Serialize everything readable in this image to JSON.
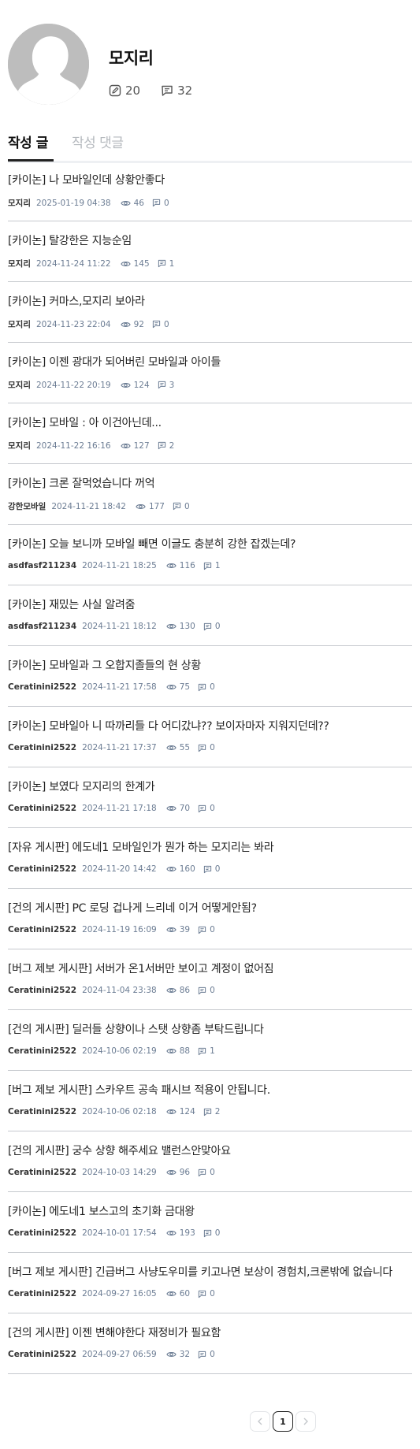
{
  "profile": {
    "nickname": "모지리",
    "post_count": "20",
    "comment_count": "32"
  },
  "tabs": {
    "posts_label": "작성 글",
    "comments_label": "작성 댓글"
  },
  "posts": [
    {
      "title": "[카이논] 나 모바일인데 상황안좋다",
      "author": "모지리",
      "date": "2025-01-19 04:38",
      "views": "46",
      "comments": "0"
    },
    {
      "title": "[카이논] 탈강한은 지능순임",
      "author": "모지리",
      "date": "2024-11-24 11:22",
      "views": "145",
      "comments": "1"
    },
    {
      "title": "[카이논] 커마스,모지리 보아라",
      "author": "모지리",
      "date": "2024-11-23 22:04",
      "views": "92",
      "comments": "0"
    },
    {
      "title": "[카이논] 이젠 광대가 되어버린 모바일과 아이들",
      "author": "모지리",
      "date": "2024-11-22 20:19",
      "views": "124",
      "comments": "3"
    },
    {
      "title": "[카이논] 모바일 : 아 이건아닌데...",
      "author": "모지리",
      "date": "2024-11-22 16:16",
      "views": "127",
      "comments": "2"
    },
    {
      "title": "[카이논] 크론 잘먹었습니다 꺼억",
      "author": "강한모바일",
      "date": "2024-11-21 18:42",
      "views": "177",
      "comments": "0"
    },
    {
      "title": "[카이논] 오늘 보니까 모바일 빼면 이글도 충분히 강한 잡겠는데?",
      "author": "asdfasf211234",
      "date": "2024-11-21 18:25",
      "views": "116",
      "comments": "1"
    },
    {
      "title": "[카이논] 재밌는 사실 알려줌",
      "author": "asdfasf211234",
      "date": "2024-11-21 18:12",
      "views": "130",
      "comments": "0"
    },
    {
      "title": "[카이논] 모바일과 그 오합지졸들의 현 상황",
      "author": "Ceratinini2522",
      "date": "2024-11-21 17:58",
      "views": "75",
      "comments": "0"
    },
    {
      "title": "[카이논] 모바일아 니 따까리들 다 어디갔냐?? 보이자마자 지워지던데??",
      "author": "Ceratinini2522",
      "date": "2024-11-21 17:37",
      "views": "55",
      "comments": "0"
    },
    {
      "title": "[카이논] 보였다 모지리의 한계가",
      "author": "Ceratinini2522",
      "date": "2024-11-21 17:18",
      "views": "70",
      "comments": "0"
    },
    {
      "title": "[자유 게시판] 에도네1 모바일인가 뭔가 하는 모지리는 봐라",
      "author": "Ceratinini2522",
      "date": "2024-11-20 14:42",
      "views": "160",
      "comments": "0"
    },
    {
      "title": "[건의 게시판] PC 로딩 겁나게 느리네 이거 어떻게안됨?",
      "author": "Ceratinini2522",
      "date": "2024-11-19 16:09",
      "views": "39",
      "comments": "0"
    },
    {
      "title": "[버그 제보 게시판] 서버가 온1서버만 보이고 계정이 없어짐",
      "author": "Ceratinini2522",
      "date": "2024-11-04 23:38",
      "views": "86",
      "comments": "0"
    },
    {
      "title": "[건의 게시판] 딜러들 상향이나 스탯 상향좀 부탁드립니다",
      "author": "Ceratinini2522",
      "date": "2024-10-06 02:19",
      "views": "88",
      "comments": "1"
    },
    {
      "title": "[버그 제보 게시판] 스카우트 공속 패시브 적용이 안됩니다.",
      "author": "Ceratinini2522",
      "date": "2024-10-06 02:18",
      "views": "124",
      "comments": "2"
    },
    {
      "title": "[건의 게시판] 궁수 상향 해주세요 밸런스안맞아요",
      "author": "Ceratinini2522",
      "date": "2024-10-03 14:29",
      "views": "96",
      "comments": "0"
    },
    {
      "title": "[카이논] 에도네1 보스고의 초기화 금대왕",
      "author": "Ceratinini2522",
      "date": "2024-10-01 17:54",
      "views": "193",
      "comments": "0"
    },
    {
      "title": "[버그 제보 게시판] 긴급버그 사냥도우미를 키고나면 보상이 경험치,크론밖에 없습니다",
      "author": "Ceratinini2522",
      "date": "2024-09-27 16:05",
      "views": "60",
      "comments": "0"
    },
    {
      "title": "[건의 게시판] 이젠 변해야한다 재정비가 필요함",
      "author": "Ceratinini2522",
      "date": "2024-09-27 06:59",
      "views": "32",
      "comments": "0"
    }
  ],
  "pagination": {
    "prev_icon": "chevron-left-icon",
    "next_icon": "chevron-right-icon",
    "current_page": "1"
  },
  "colors": {
    "meta_blue": "#6b7c93",
    "divider": "#c6c9ce",
    "avatar_gray": "#bdbdbd"
  }
}
